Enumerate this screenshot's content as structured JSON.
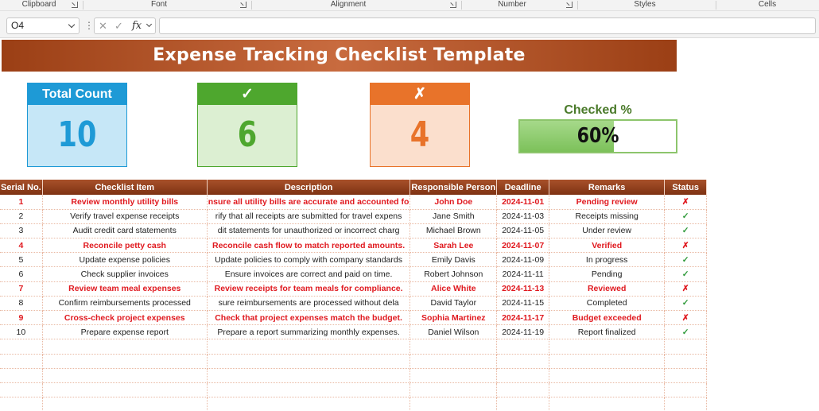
{
  "ribbon": {
    "groups": [
      "Clipboard",
      "Font",
      "Alignment",
      "Number",
      "Styles",
      "Cells"
    ]
  },
  "formula_bar": {
    "name_box": "O4",
    "cancel_icon": "close-icon",
    "enter_icon": "check-icon",
    "fx_label": "fx",
    "formula": ""
  },
  "title": "Expense Tracking Checklist Template",
  "kpis": {
    "total": {
      "label": "Total Count",
      "value": "10",
      "color": "#1e9ad6"
    },
    "checked": {
      "label": "✓",
      "value": "6",
      "color": "#4ea72e"
    },
    "unchecked": {
      "label": "✗",
      "value": "4",
      "color": "#e8732a"
    }
  },
  "checked_pct": {
    "label": "Checked %",
    "value": "60%",
    "fraction": 0.6
  },
  "table": {
    "headers": [
      "Serial No.",
      "Checklist Item",
      "Description",
      "Responsible Person",
      "Deadline",
      "Remarks",
      "Status"
    ],
    "rows": [
      {
        "serial": "1",
        "item": "Review monthly utility bills",
        "description": "nsure all utility bills are accurate and accounted fo",
        "person": "John Doe",
        "deadline": "2024-11-01",
        "remarks": "Pending review",
        "status": "✗"
      },
      {
        "serial": "2",
        "item": "Verify travel expense receipts",
        "description": "rify that all receipts are submitted for travel expens",
        "person": "Jane Smith",
        "deadline": "2024-11-03",
        "remarks": "Receipts missing",
        "status": "✓"
      },
      {
        "serial": "3",
        "item": "Audit credit card statements",
        "description": "dit statements for unauthorized or incorrect charg",
        "person": "Michael Brown",
        "deadline": "2024-11-05",
        "remarks": "Under review",
        "status": "✓"
      },
      {
        "serial": "4",
        "item": "Reconcile petty cash",
        "description": "Reconcile cash flow to match reported amounts.",
        "person": "Sarah Lee",
        "deadline": "2024-11-07",
        "remarks": "Verified",
        "status": "✗"
      },
      {
        "serial": "5",
        "item": "Update expense policies",
        "description": "Update policies to comply with company standards",
        "person": "Emily Davis",
        "deadline": "2024-11-09",
        "remarks": "In progress",
        "status": "✓"
      },
      {
        "serial": "6",
        "item": "Check supplier invoices",
        "description": "Ensure invoices are correct and paid on time.",
        "person": "Robert Johnson",
        "deadline": "2024-11-11",
        "remarks": "Pending",
        "status": "✓"
      },
      {
        "serial": "7",
        "item": "Review team meal expenses",
        "description": "Review receipts for team meals for compliance.",
        "person": "Alice White",
        "deadline": "2024-11-13",
        "remarks": "Reviewed",
        "status": "✗"
      },
      {
        "serial": "8",
        "item": "Confirm reimbursements processed",
        "description": "sure reimbursements are processed without dela",
        "person": "David Taylor",
        "deadline": "2024-11-15",
        "remarks": "Completed",
        "status": "✓"
      },
      {
        "serial": "9",
        "item": "Cross-check project expenses",
        "description": "Check that project expenses match the budget.",
        "person": "Sophia Martinez",
        "deadline": "2024-11-17",
        "remarks": "Budget exceeded",
        "status": "✗"
      },
      {
        "serial": "10",
        "item": "Prepare expense report",
        "description": "Prepare a report summarizing monthly expenses.",
        "person": "Daniel Wilson",
        "deadline": "2024-11-19",
        "remarks": "Report finalized",
        "status": "✓"
      }
    ],
    "empty_rows": 5
  }
}
